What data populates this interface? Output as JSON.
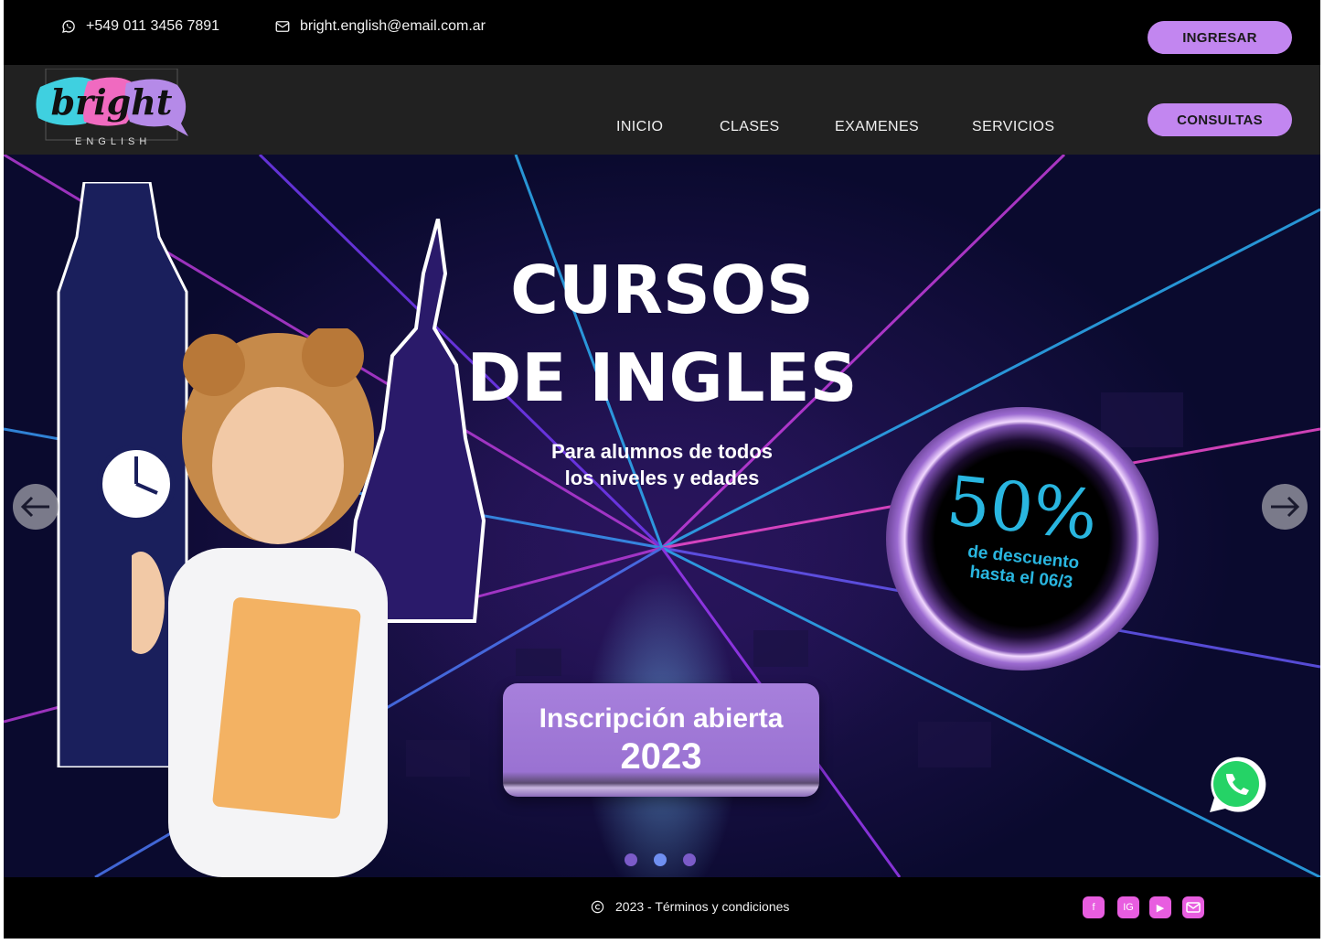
{
  "topbar": {
    "phone_icon": "whatsapp-outline-icon",
    "phone": "+549 011 3456 7891",
    "email_icon": "mail-icon",
    "email": "bright.english@email.com.ar",
    "login_label": "INGRESAR"
  },
  "brand": {
    "logo_word": "bright",
    "logo_sub": "ENGLISH"
  },
  "nav": {
    "items": [
      "INICIO",
      "CLASES",
      "EXAMENES",
      "SERVICIOS"
    ],
    "cta_label": "CONSULTAS"
  },
  "hero": {
    "title_line1": "CURSOS",
    "title_line2": "DE INGLES",
    "subtitle_line1": "Para alumnos de todos",
    "subtitle_line2": "los niveles y edades",
    "promo_value": "50%",
    "promo_line1": "de descuento",
    "promo_line2": "hasta el 06/3",
    "enroll_line1": "Inscripción abierta",
    "enroll_line2": "2023",
    "prev_icon": "arrow-left-icon",
    "next_icon": "arrow-right-icon",
    "slide_count": 3,
    "active_slide": 2
  },
  "footer": {
    "copyright_icon": "copyright-icon",
    "copyright_text": "2023 - Términos y condiciones",
    "social": [
      {
        "icon": "facebook-icon",
        "label": "f"
      },
      {
        "icon": "instagram-icon",
        "label": "IG"
      },
      {
        "icon": "youtube-icon",
        "label": "▶"
      },
      {
        "icon": "mail-icon",
        "label": ""
      }
    ]
  },
  "colors": {
    "accent": "#c286f0",
    "promo": "#29b6e0",
    "social": "#e85de0",
    "whatsapp": "#25d366"
  }
}
